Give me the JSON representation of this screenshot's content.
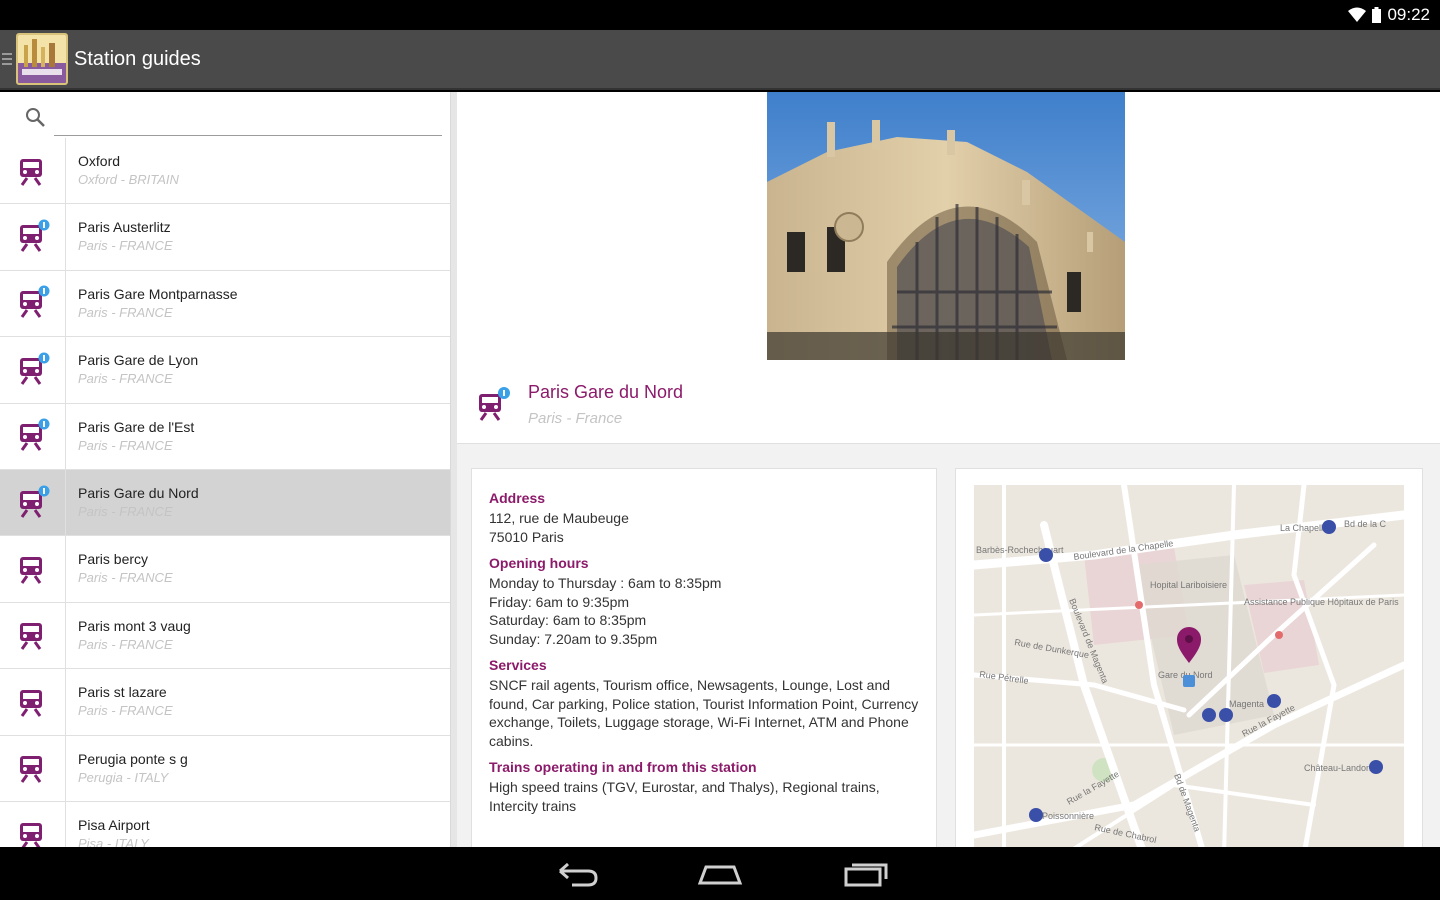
{
  "status_bar": {
    "time": "09:22",
    "icons": [
      "wifi-icon",
      "battery-icon"
    ]
  },
  "action_bar": {
    "title": "Station guides"
  },
  "search": {
    "placeholder": "",
    "value": ""
  },
  "colors": {
    "accent": "#8c1a6a",
    "train_icon": "#7f1f70",
    "badge": "#3aa0e8"
  },
  "stations": [
    {
      "name": "Oxford",
      "sub": "Oxford - BRITAIN",
      "badge": false,
      "selected": false
    },
    {
      "name": "Paris Austerlitz",
      "sub": "Paris - FRANCE",
      "badge": true,
      "selected": false
    },
    {
      "name": "Paris Gare Montparnasse",
      "sub": "Paris - FRANCE",
      "badge": true,
      "selected": false
    },
    {
      "name": "Paris Gare de Lyon",
      "sub": "Paris - FRANCE",
      "badge": true,
      "selected": false
    },
    {
      "name": "Paris Gare de l'Est",
      "sub": "Paris - FRANCE",
      "badge": true,
      "selected": false
    },
    {
      "name": "Paris Gare du Nord",
      "sub": "Paris - FRANCE",
      "badge": true,
      "selected": true
    },
    {
      "name": "Paris bercy",
      "sub": "Paris - FRANCE",
      "badge": false,
      "selected": false
    },
    {
      "name": "Paris mont 3 vaug",
      "sub": "Paris - FRANCE",
      "badge": false,
      "selected": false
    },
    {
      "name": "Paris st lazare",
      "sub": "Paris - FRANCE",
      "badge": false,
      "selected": false
    },
    {
      "name": "Perugia ponte s g",
      "sub": "Perugia - ITALY",
      "badge": false,
      "selected": false
    },
    {
      "name": "Pisa Airport",
      "sub": "Pisa - ITALY",
      "badge": false,
      "selected": false
    }
  ],
  "detail": {
    "title": "Paris Gare du Nord",
    "subtitle": "Paris - France",
    "address_heading": "Address",
    "address_lines": [
      "112, rue de Maubeuge",
      "75010 Paris"
    ],
    "hours_heading": "Opening hours",
    "hours_lines": [
      "Monday to Thursday : 6am to 8:35pm",
      "Friday: 6am to 9:35pm",
      "Saturday: 6am to 8:35pm",
      "Sunday: 7.20am to 9.35pm"
    ],
    "services_heading": "Services",
    "services_text": "SNCF rail agents, Tourism office, Newsagents, Lounge, Lost and found, Car parking, Police station, Tourist Information Point, Currency exchange, Toilets, Luggage storage, Wi-Fi Internet, ATM and Phone cabins.",
    "trains_heading": "Trains operating in and from this station",
    "trains_text": "High speed trains (TGV, Eurostar, and Thalys), Regional trains, Intercity trains"
  },
  "map": {
    "labels": {
      "boulevard_chapelle": "Boulevard de la Chapelle",
      "bd_magenta": "Boulevard de Magenta",
      "hopital": "Hopital Lariboisiere",
      "assistance": "Assistance Publique Hôpitaux de Paris",
      "gare_du_nord": "Gare du Nord",
      "la_chapelle": "La Chapelle",
      "barbes": "Barbès-Rochechouart",
      "magenta": "Magenta",
      "chateau_landon": "Château-Landon",
      "poissonniere": "Poissonnière",
      "rue_lafayette": "Rue la Fayette",
      "rue_dunkerque": "Rue de Dunkerque",
      "rue_petrelle": "Rue Pétrelle",
      "bd_de_la_c": "Bd de la C",
      "rue_chabrol": "Rue de Chabrol",
      "rue_lafayette2": "Rue la Fayette",
      "bd_magenta2": "Bd de Magenta"
    }
  },
  "nav": {
    "buttons": [
      "back-icon",
      "home-icon",
      "recent-apps-icon"
    ]
  }
}
